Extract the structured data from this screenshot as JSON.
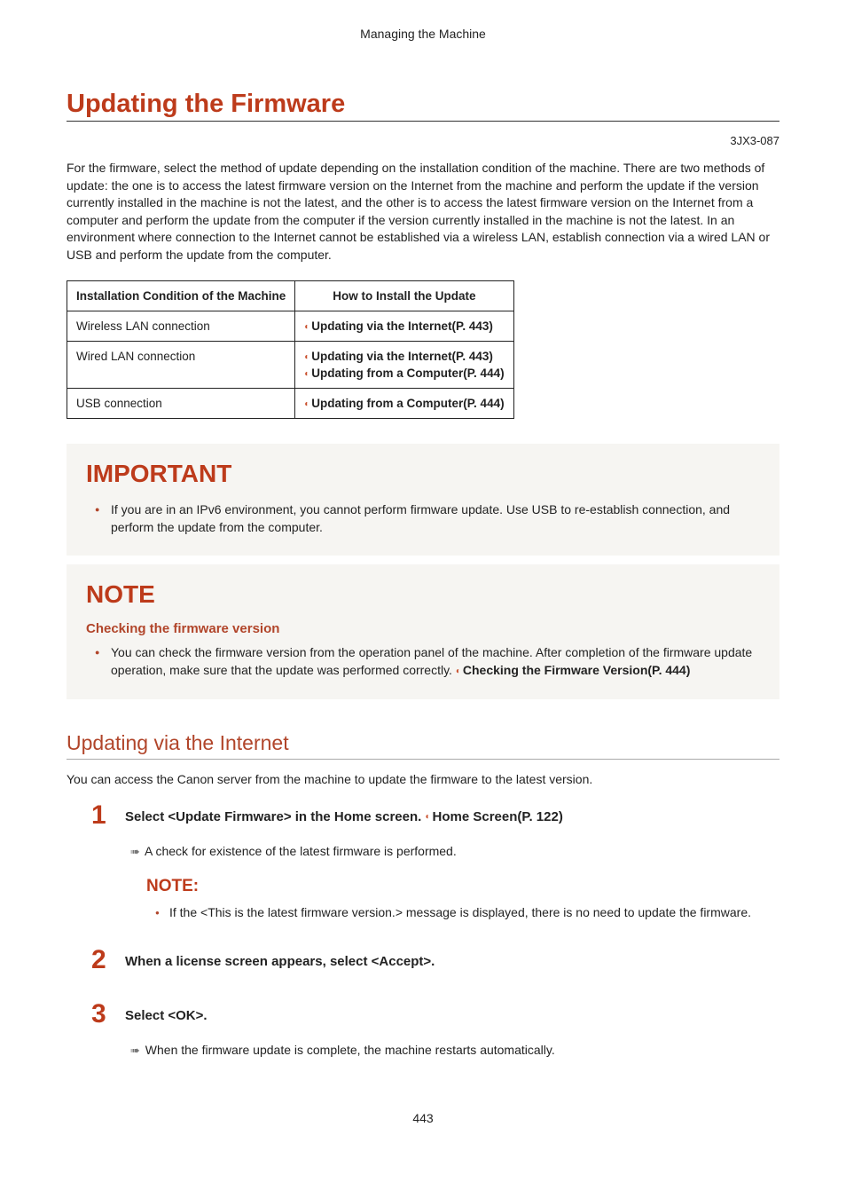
{
  "runningHead": "Managing the Machine",
  "title": "Updating the Firmware",
  "docCode": "3JX3-087",
  "intro": "For the firmware, select the method of update depending on the installation condition of the machine. There are two methods of update: the one is to access the latest firmware version on the Internet from the machine and perform the update if the version currently installed in the machine is not the latest, and the other is to access the latest firmware version on the Internet from a computer and perform the update from the computer if the version currently installed in the machine is not the latest. In an environment where connection to the Internet cannot be established via a wireless LAN, establish connection via a wired LAN or USB and perform the update from the computer.",
  "table": {
    "head": [
      "Installation Condition of the Machine",
      "How to Install the Update"
    ],
    "rows": [
      {
        "cond": "Wireless LAN connection",
        "links": [
          "Updating via the Internet(P. 443)"
        ]
      },
      {
        "cond": "Wired LAN connection",
        "links": [
          "Updating via the Internet(P. 443)",
          "Updating from a Computer(P. 444)"
        ]
      },
      {
        "cond": "USB connection",
        "links": [
          "Updating from a Computer(P. 444)"
        ]
      }
    ]
  },
  "important": {
    "title": "IMPORTANT",
    "items": [
      "If you are in an IPv6 environment, you cannot perform firmware update. Use USB to re-establish connection, and perform the update from the computer."
    ]
  },
  "note": {
    "title": "NOTE",
    "subhead": "Checking the firmware version",
    "text": "You can check the firmware version from the operation panel of the machine. After completion of the firmware update operation, make sure that the update was performed correctly. ",
    "link": "Checking the Firmware Version(P. 444)"
  },
  "section": {
    "title": "Updating via the Internet",
    "lead": "You can access the Canon server from the machine to update the firmware to the latest version.",
    "steps": [
      {
        "num": "1",
        "titlePre": "Select <Update Firmware> in the Home screen. ",
        "titleLink": "Home Screen(P. 122)",
        "arrow": "A check for existence of the latest firmware is performed.",
        "noteLabel": "NOTE:",
        "noteItem": "If the <This is the latest firmware version.> message is displayed, there is no need to update the firmware."
      },
      {
        "num": "2",
        "titlePre": "When a license screen appears, select <Accept>."
      },
      {
        "num": "3",
        "titlePre": "Select <OK>.",
        "arrow": "When the firmware update is complete, the machine restarts automatically."
      }
    ]
  },
  "pageNum": "443"
}
